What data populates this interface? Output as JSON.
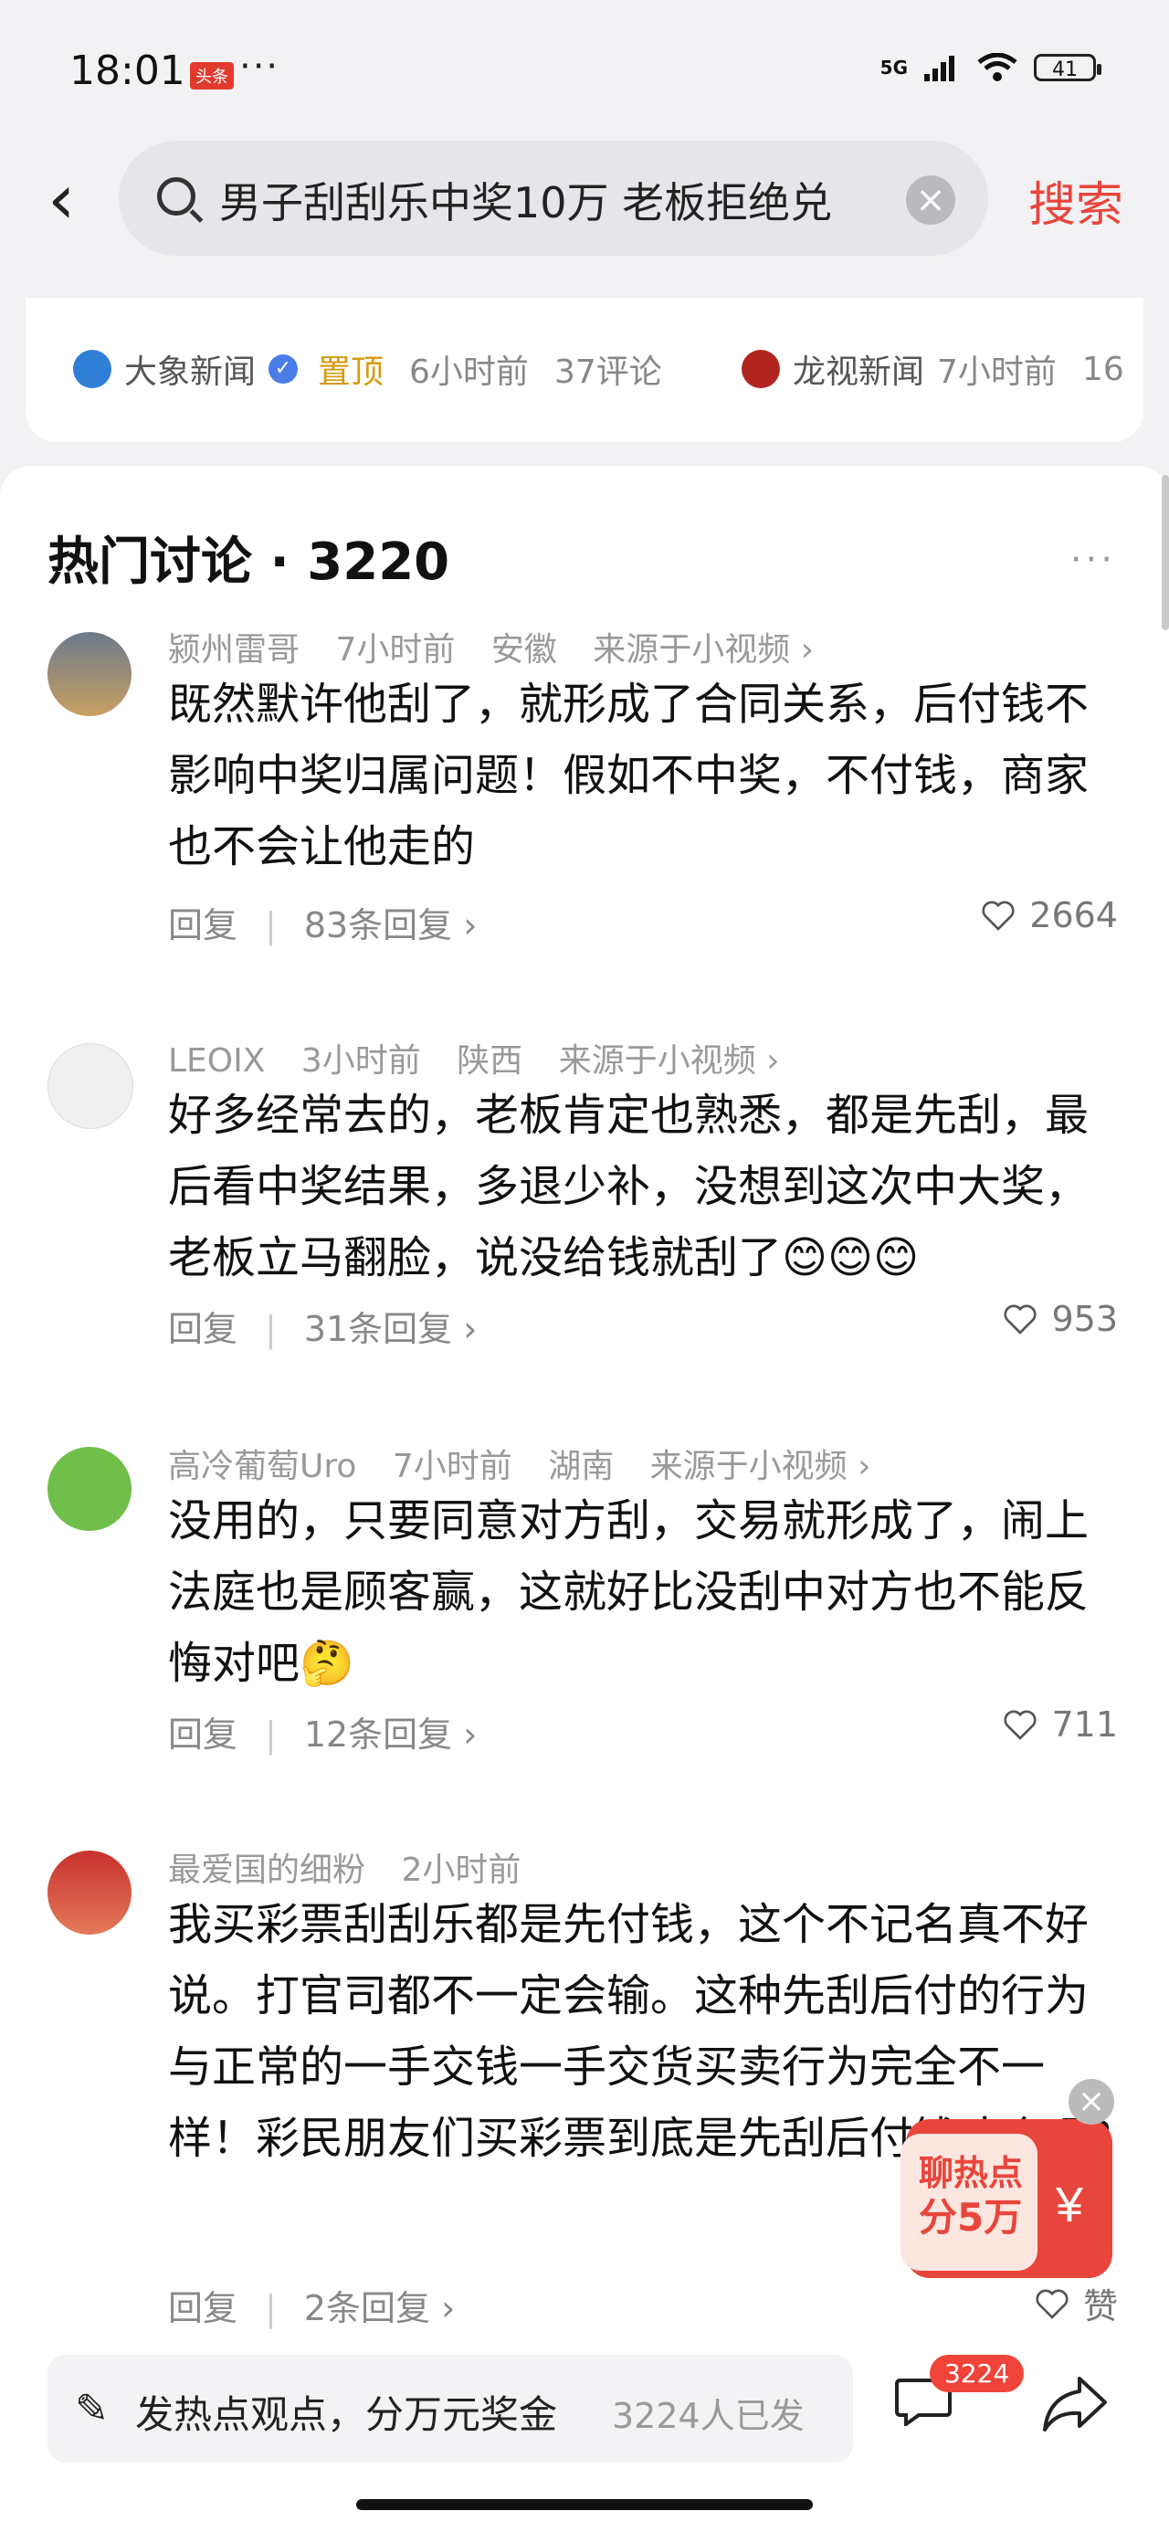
{
  "status_bar": {
    "time": "18:01",
    "badge": "头条",
    "dots": "···",
    "network": "5G",
    "battery": "41"
  },
  "search": {
    "query": "男子刮刮乐中奖10万 老板拒绝兑",
    "button": "搜索"
  },
  "top_news": {
    "items": [
      {
        "source": "大象新闻",
        "pinned": "置顶",
        "time": "6小时前",
        "comments": "37评论"
      },
      {
        "source": "龙视新闻",
        "time": "7小时前",
        "comments": "16"
      }
    ]
  },
  "discussion": {
    "title": "热门讨论 · 3220",
    "comments": [
      {
        "user": "颍州雷哥",
        "time": "7小时前",
        "location": "安徽",
        "source": "来源于小视频 ›",
        "text": "既然默许他刮了，就形成了合同关系，后付钱不影响中奖归属问题！假如不中奖，不付钱，商家也不会让他走的",
        "reply": "回复",
        "replies": "83条回复 ›",
        "likes": "2664"
      },
      {
        "user": "LEOIX",
        "time": "3小时前",
        "location": "陕西",
        "source": "来源于小视频 ›",
        "text": "好多经常去的，老板肯定也熟悉，都是先刮，最后看中奖结果，多退少补，没想到这次中大奖，老板立马翻脸，说没给钱就刮了😊😊😊",
        "reply": "回复",
        "replies": "31条回复 ›",
        "likes": "953"
      },
      {
        "user": "高冷葡萄Uro",
        "time": "7小时前",
        "location": "湖南",
        "source": "来源于小视频 ›",
        "text": "没用的，只要同意对方刮，交易就形成了，闹上法庭也是顾客赢，这就好比没刮中对方也不能反悔对吧🤔",
        "reply": "回复",
        "replies": "12条回复 ›",
        "likes": "711"
      },
      {
        "user": "最爱国的细粉",
        "time": "2小时前",
        "text": "我买彩票刮刮乐都是先付钱，这个不记名真不好说。打官司都不一定会输。这种先刮后付的行为与正常的一手交钱一手交货买卖行为完全不一样！彩民朋友们买彩票到底是先刮后付钱才合理?",
        "reply": "回复",
        "replies": "2条回复 ›",
        "likes": "赞"
      }
    ]
  },
  "promo": {
    "line1": "聊热点",
    "line2": "分5万",
    "currency": "¥"
  },
  "bottom": {
    "input_text": "发热点观点，分万元奖金",
    "count_text": "3224人已发",
    "comment_count": "3224"
  },
  "colors": {
    "accent": "#e8453c",
    "pinned": "#d49a0f"
  }
}
